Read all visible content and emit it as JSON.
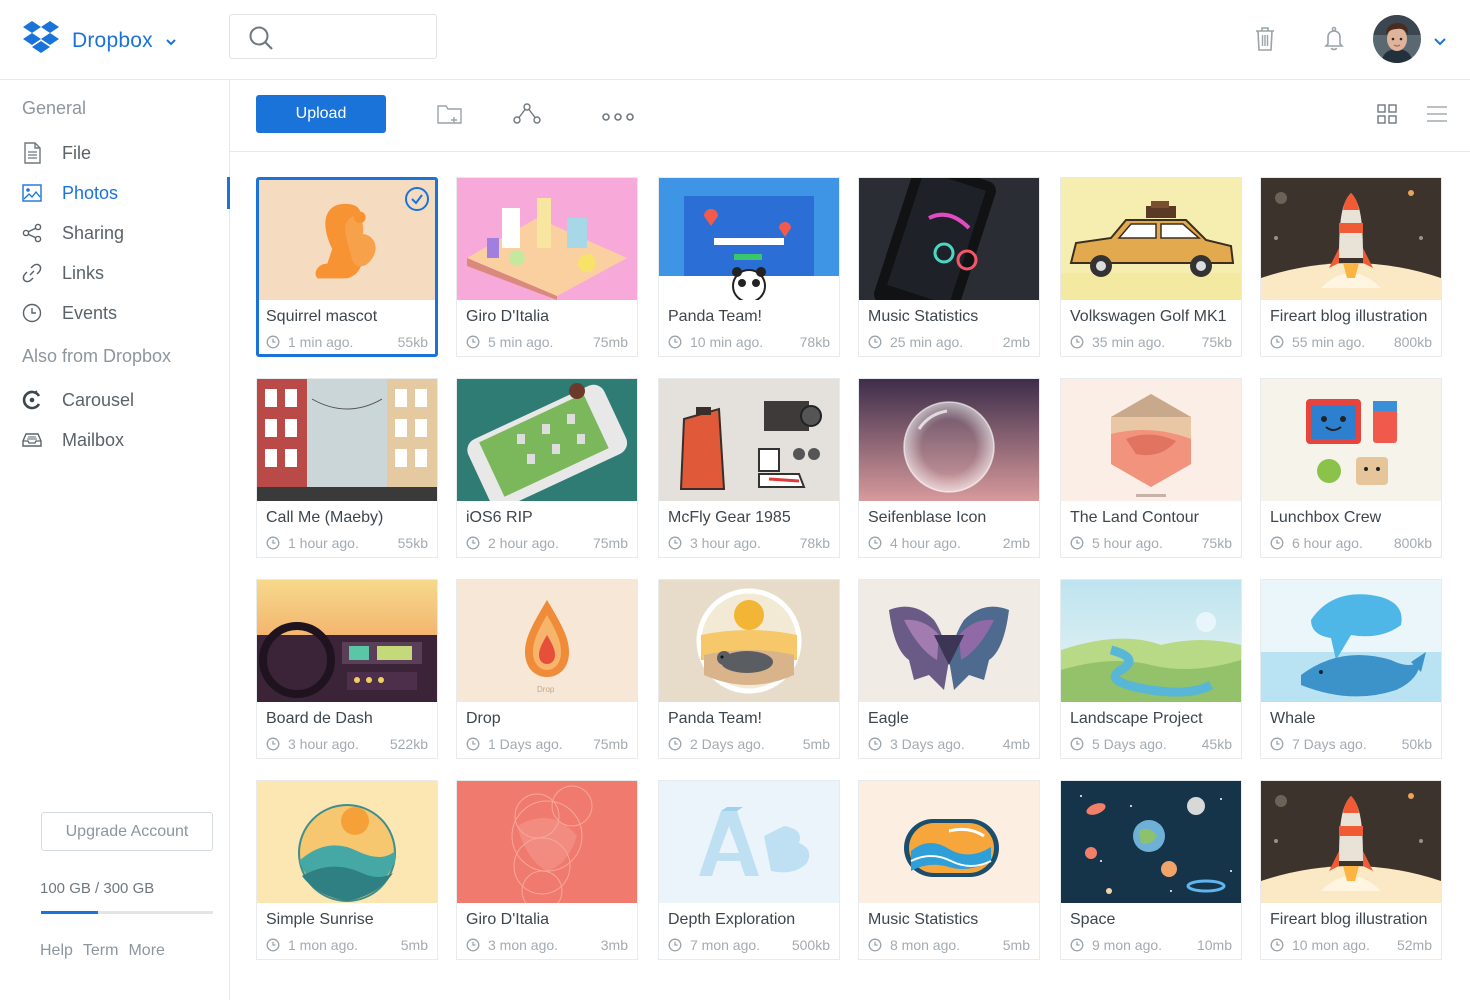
{
  "brand": {
    "name": "Dropbox",
    "color": "#1a73d9"
  },
  "search": {
    "placeholder": ""
  },
  "topbar": {
    "icons": [
      "trash-icon",
      "bell-icon"
    ],
    "avatar": "user-avatar"
  },
  "sidebar": {
    "general_heading": "General",
    "items": [
      {
        "label": "File",
        "icon": "file-icon"
      },
      {
        "label": "Photos",
        "icon": "photo-icon",
        "active": true
      },
      {
        "label": "Sharing",
        "icon": "share-icon"
      },
      {
        "label": "Links",
        "icon": "link-icon"
      },
      {
        "label": "Events",
        "icon": "clock-icon"
      }
    ],
    "also_heading": "Also from Dropbox",
    "also_items": [
      {
        "label": "Carousel",
        "icon": "carousel-icon"
      },
      {
        "label": "Mailbox",
        "icon": "mailbox-icon"
      }
    ],
    "upgrade_label": "Upgrade Account",
    "storage_text": "100 GB / 300 GB",
    "storage_fraction": 0.333,
    "footer_links": [
      "Help",
      "Term",
      "More"
    ]
  },
  "toolbar": {
    "upload_label": "Upload",
    "icons": [
      "new-folder-icon",
      "share-nodes-icon",
      "more-icon"
    ],
    "view_icons": [
      "grid-view-icon",
      "list-view-icon"
    ]
  },
  "files": [
    {
      "title": "Squirrel mascot",
      "time": "1 min ago.",
      "size": "55kb",
      "selected": true,
      "thumb": "squirrel"
    },
    {
      "title": "Giro D'Italia",
      "time": "5 min ago.",
      "size": "75mb",
      "thumb": "pink-city"
    },
    {
      "title": "Panda Team!",
      "time": "10 min ago.",
      "size": "78kb",
      "thumb": "panda-web"
    },
    {
      "title": "Music Statistics",
      "time": "25 min ago.",
      "size": "2mb",
      "thumb": "phone-dark"
    },
    {
      "title": "Volkswagen Golf MK1",
      "time": "35 min ago.",
      "size": "75kb",
      "thumb": "car"
    },
    {
      "title": "Fireart blog illustration",
      "time": "55 min ago.",
      "size": "800kb",
      "thumb": "rocket"
    },
    {
      "title": "Call Me (Maeby)",
      "time": "1 hour ago.",
      "size": "55kb",
      "thumb": "building"
    },
    {
      "title": "iOS6 RIP",
      "time": "2 hour ago.",
      "size": "75mb",
      "thumb": "phone-graves"
    },
    {
      "title": "McFly Gear 1985",
      "time": "3 hour ago.",
      "size": "78kb",
      "thumb": "gear"
    },
    {
      "title": "Seifenblase Icon",
      "time": "4 hour ago.",
      "size": "2mb",
      "thumb": "bubble"
    },
    {
      "title": "The Land Contour",
      "time": "5 hour ago.",
      "size": "75kb",
      "thumb": "land"
    },
    {
      "title": "Lunchbox Crew",
      "time": "6 hour ago.",
      "size": "800kb",
      "thumb": "lunchbox"
    },
    {
      "title": "Board de Dash",
      "time": "3 hour ago.",
      "size": "522kb",
      "thumb": "dash"
    },
    {
      "title": "Drop",
      "time": "1 Days ago.",
      "size": "75mb",
      "thumb": "drop"
    },
    {
      "title": "Panda Team!",
      "time": "2 Days ago.",
      "size": "5mb",
      "thumb": "seal"
    },
    {
      "title": "Eagle",
      "time": "3 Days ago.",
      "size": "4mb",
      "thumb": "eagle"
    },
    {
      "title": "Landscape Project",
      "time": "5 Days ago.",
      "size": "45kb",
      "thumb": "landscape"
    },
    {
      "title": "Whale",
      "time": "7 Days ago.",
      "size": "50kb",
      "thumb": "whale"
    },
    {
      "title": "Simple Sunrise",
      "time": "1 mon ago.",
      "size": "5mb",
      "thumb": "sunrise"
    },
    {
      "title": "Giro D'Italia",
      "time": "3 mon ago.",
      "size": "3mb",
      "thumb": "circles"
    },
    {
      "title": "Depth Exploration",
      "time": "7 mon ago.",
      "size": "500kb",
      "thumb": "letters"
    },
    {
      "title": "Music Statistics",
      "time": "8 mon ago.",
      "size": "5mb",
      "thumb": "waves"
    },
    {
      "title": "Space",
      "time": "9 mon ago.",
      "size": "10mb",
      "thumb": "space"
    },
    {
      "title": "Fireart blog illustration",
      "time": "10 mon ago.",
      "size": "52mb",
      "thumb": "rocket"
    }
  ]
}
